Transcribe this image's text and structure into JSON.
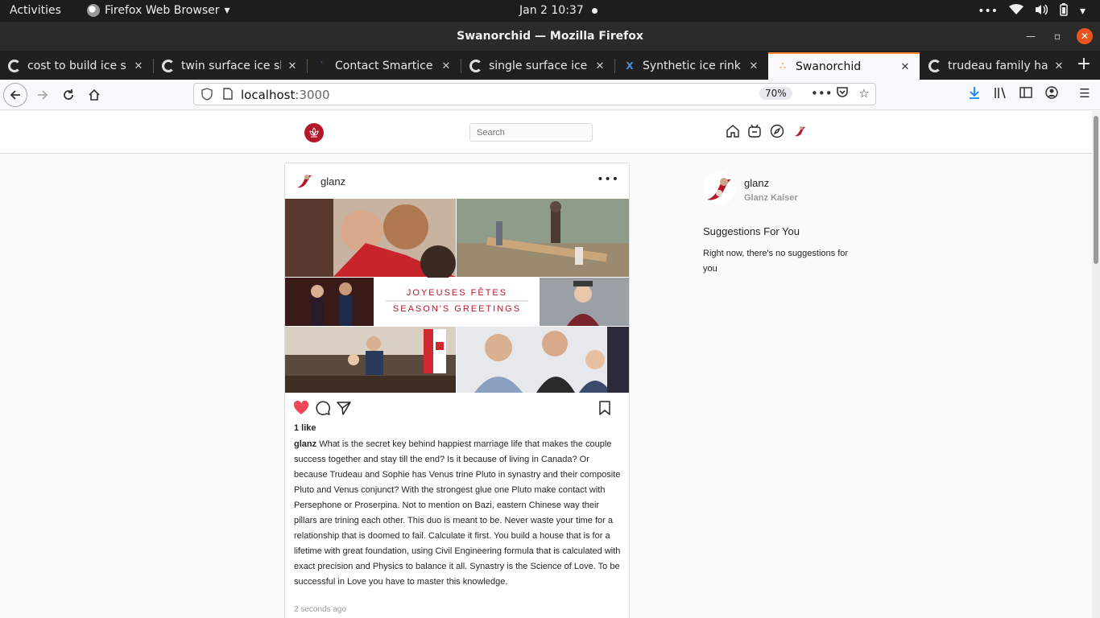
{
  "os_topbar": {
    "activities": "Activities",
    "app_name": "Firefox Web Browser",
    "clock": "Jan 2  10:37"
  },
  "window": {
    "title": "Swanorchid — Mozilla Firefox"
  },
  "tabs": [
    {
      "label": "cost to build ice ska",
      "favicon": "google-icon"
    },
    {
      "label": "twin surface ice ska",
      "favicon": "google-icon"
    },
    {
      "label": "Contact Smartice | A",
      "favicon": "smartice-icon"
    },
    {
      "label": "single surface ice sk",
      "favicon": "google-icon"
    },
    {
      "label": "Synthetic ice rink | X",
      "favicon": "x-icon"
    },
    {
      "label": "Swanorchid",
      "favicon": "swanorchid-icon",
      "active": true
    },
    {
      "label": "trudeau family happ",
      "favicon": "google-icon"
    }
  ],
  "navbar": {
    "url_host": "localhost",
    "url_port": ":3000",
    "zoom": "70%"
  },
  "site": {
    "search_placeholder": "Search",
    "colors": {
      "brand": "#b5172a",
      "like": "#ed4956"
    }
  },
  "post": {
    "username": "glanz",
    "image_text_line1": "JOYEUSES FÊTES",
    "image_text_line2": "SEASON'S GREETINGS",
    "likes": "1 like",
    "caption_user": "glanz",
    "caption_text": "What is the secret key behind happiest marriage life that makes the couple success together and stay till the end? Is it because of living in Canada? Or because Trudeau and Sophie has Venus trine Pluto in synastry and their composite Pluto and Venus conjunct? With the strongest glue one Pluto make contact with Persephone or Proserpina. Not to mention on Bazi, eastern Chinese way their pillars are trining each other. This duo is meant to be. Never waste your time for a relationship that is doomed to fail. Calculate it first. You build a house that is for a lifetime with great foundation, using Civil Engineering formula that is calculated with exact precision and Physics to balance it all. Synastry is the Science of Love. To be successful in Love you have to master this knowledge.",
    "time": "2 seconds ago"
  },
  "sidebar": {
    "username": "glanz",
    "fullname": "Glanz Kaiser",
    "suggestions_title": "Suggestions For You",
    "suggestions_empty": "Right now, there's no suggestions for you"
  }
}
